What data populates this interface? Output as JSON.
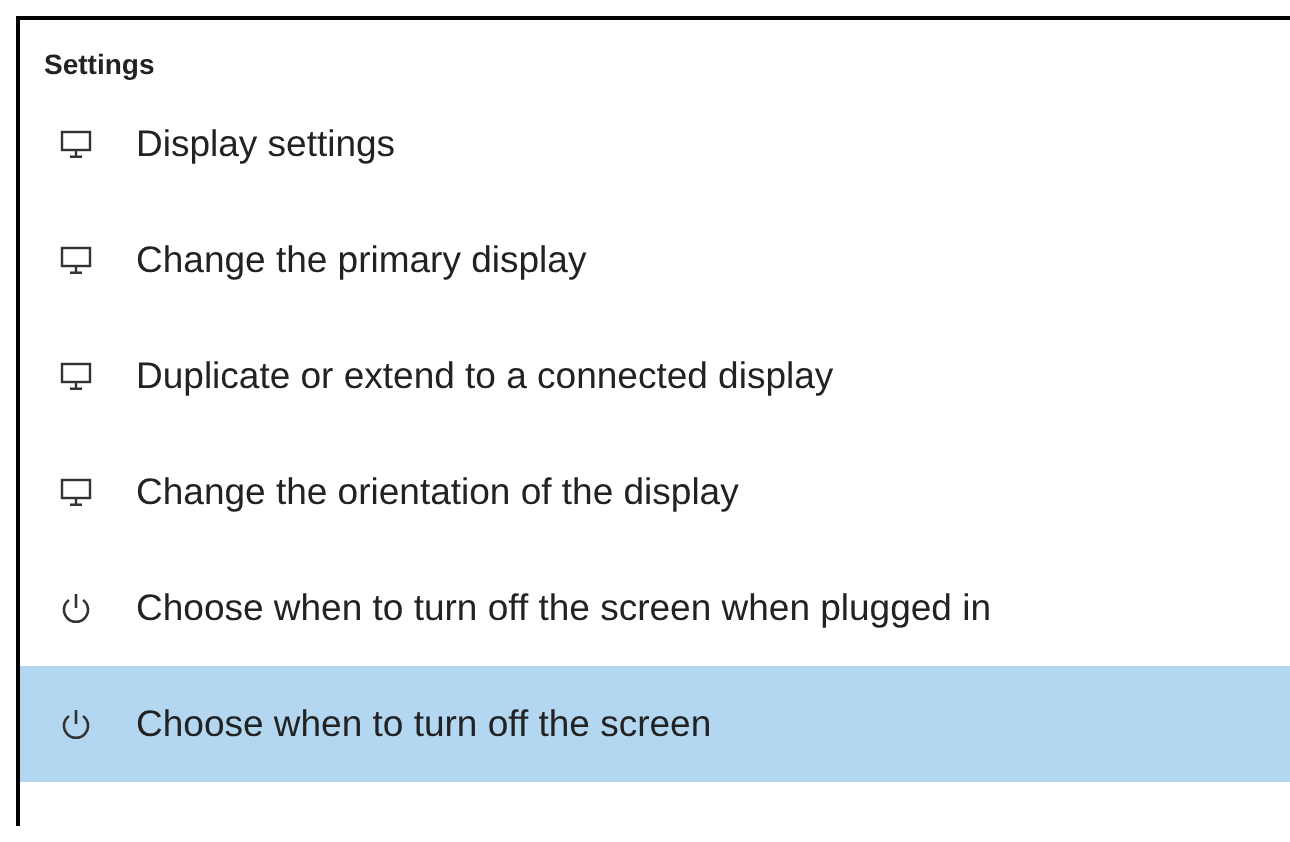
{
  "header": "Settings",
  "items": [
    {
      "kind": "display",
      "label": "Display settings",
      "selected": false
    },
    {
      "kind": "display",
      "label": "Change the primary display",
      "selected": false
    },
    {
      "kind": "display",
      "label": "Duplicate or extend to a connected display",
      "selected": false
    },
    {
      "kind": "display",
      "label": "Change the orientation of the display",
      "selected": false
    },
    {
      "kind": "power",
      "label": "Choose when to turn off the screen when plugged in",
      "selected": false
    },
    {
      "kind": "power",
      "label": "Choose when to turn off the screen",
      "selected": true
    }
  ]
}
